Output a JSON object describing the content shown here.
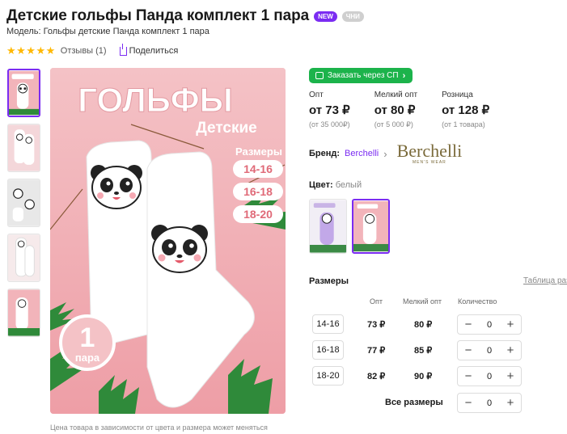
{
  "product": {
    "title": "Детские гольфы Панда комплект 1 пара",
    "badge_new": "NEW",
    "badge_extra": "ЧНИ",
    "model": "Модель: Гольфы детские Панда комплект 1 пара",
    "stars": "★★★★★",
    "reviews": "Отзывы (1)",
    "share": "Поделиться",
    "price_note": "Цена товара в зависимости от цвета и размера может меняться"
  },
  "image_text": {
    "headline": "ГОЛЬФЫ",
    "subline": "Детские",
    "sizes_label": "Размеры",
    "sizes": [
      "14-16",
      "16-18",
      "18-20"
    ],
    "pair_count": "1",
    "pair_word": "пара"
  },
  "order_button": {
    "label": "Заказать через СП"
  },
  "prices": [
    {
      "label": "Опт",
      "value": "от 73 ₽",
      "note": "(от 35 000₽)"
    },
    {
      "label": "Мелкий опт",
      "value": "от 80 ₽",
      "note": "(от 5 000 ₽)"
    },
    {
      "label": "Розница",
      "value": "от 128 ₽",
      "note": "(от 1 товара)"
    }
  ],
  "brand": {
    "label": "Бренд:",
    "link": "Berchelli",
    "logo_name": "Berchelli",
    "logo_sub": "MEN'S WEAR"
  },
  "color": {
    "label": "Цвет:",
    "value": "белый"
  },
  "sizes": {
    "title": "Размеры",
    "table_link": "Таблица раз",
    "headers": {
      "opt": "Опт",
      "small_opt": "Мелкий опт",
      "qty": "Количество"
    },
    "rows": [
      {
        "size": "14-16",
        "opt": "73 ₽",
        "small_opt": "80 ₽",
        "qty": "0"
      },
      {
        "size": "16-18",
        "opt": "77 ₽",
        "small_opt": "85 ₽",
        "qty": "0"
      },
      {
        "size": "18-20",
        "opt": "82 ₽",
        "small_opt": "90 ₽",
        "qty": "0"
      }
    ],
    "all_label": "Все размеры",
    "all_qty": "0",
    "minus": "−",
    "plus": "+"
  },
  "colors": {
    "accent": "#7b2cf2",
    "green": "#1cb34b",
    "star": "#ffb800",
    "pink_bg": "#f2b4ba"
  }
}
